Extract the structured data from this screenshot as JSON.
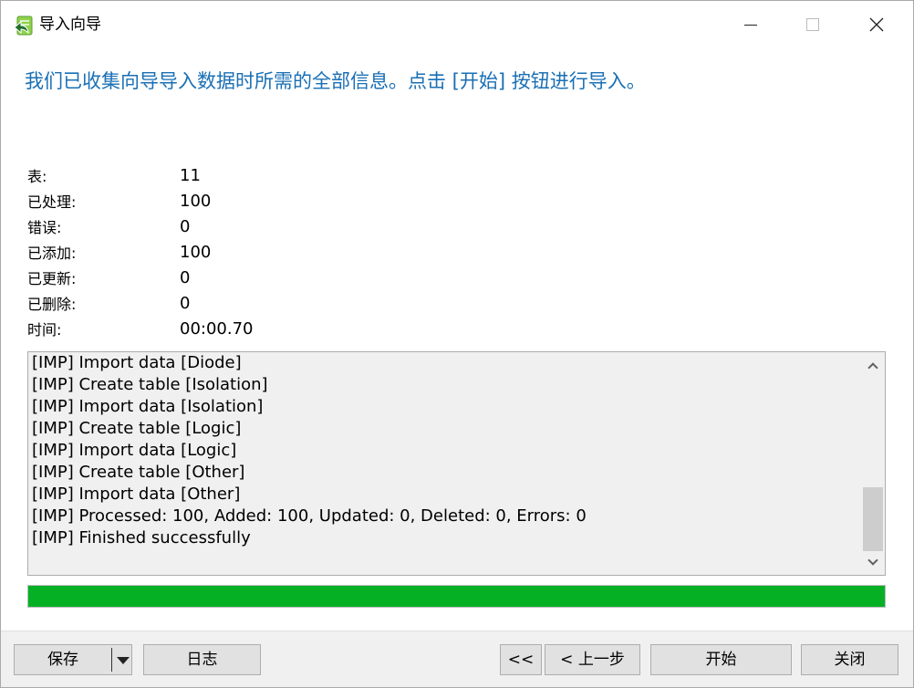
{
  "window": {
    "title": "导入向导"
  },
  "headline": "我们已收集向导导入数据时所需的全部信息。点击 [开始] 按钮进行导入。",
  "stats": [
    {
      "label": "表:",
      "value": "11"
    },
    {
      "label": "已处理:",
      "value": "100"
    },
    {
      "label": "错误:",
      "value": "0"
    },
    {
      "label": "已添加:",
      "value": "100"
    },
    {
      "label": "已更新:",
      "value": "0"
    },
    {
      "label": "已删除:",
      "value": "0"
    },
    {
      "label": "时间:",
      "value": "00:00.70"
    }
  ],
  "log": {
    "lines": [
      "[IMP] Import data [Diode]",
      "[IMP] Create table [Isolation]",
      "[IMP] Import data [Isolation]",
      "[IMP] Create table [Logic]",
      "[IMP] Import data [Logic]",
      "[IMP] Create table [Other]",
      "[IMP] Import data [Other]",
      "[IMP] Processed: 100, Added: 100, Updated: 0, Deleted: 0, Errors: 0",
      "[IMP] Finished successfully"
    ]
  },
  "progress": {
    "percent": 100,
    "color": "#06b025"
  },
  "footer": {
    "save_label": "保存",
    "log_label": "日志",
    "first_label": "<<",
    "prev_label": "< 上一步",
    "start_label": "开始",
    "close_label": "关闭"
  },
  "colors": {
    "headline": "#1a6fb4",
    "accent": "#06b025"
  },
  "icons": {
    "app": "import-wizard-icon",
    "minimize": "minimize-icon",
    "maximize": "maximize-icon",
    "close": "close-icon"
  }
}
